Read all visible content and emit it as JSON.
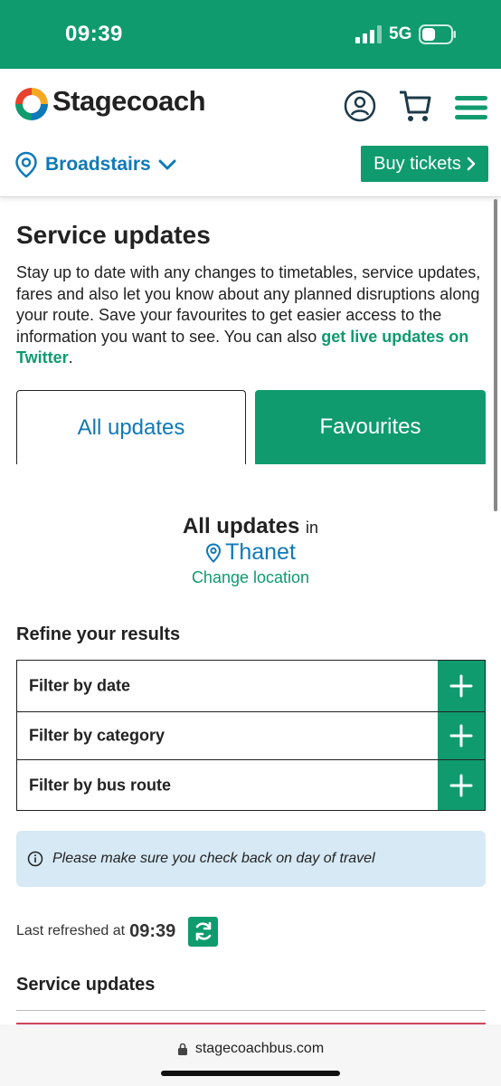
{
  "status": {
    "time": "09:39",
    "network": "5G"
  },
  "header": {
    "brand": "Stagecoach",
    "location": "Broadstairs",
    "buy_label": "Buy tickets"
  },
  "main": {
    "title": "Service updates",
    "intro": "Stay up to date with any changes to timetables, service updates, fares and also let you know about any planned disruptions along your route. Save your favourites to get easier access to the information you want to see. You can also ",
    "intro_link": "get live updates on Twitter",
    "intro_end": ".",
    "tabs": {
      "all": "All updates",
      "favourites": "Favourites"
    },
    "all_updates_heading": "All updates",
    "in_word": "in",
    "place": "Thanet",
    "change_location": "Change location",
    "refine": "Refine your results",
    "filters": [
      "Filter by date",
      "Filter by category",
      "Filter by bus route"
    ],
    "notice": "Please make sure you check back on day of travel",
    "last_refreshed_label": "Last refreshed at",
    "last_refreshed_time": "09:39",
    "section_title": "Service updates"
  },
  "browser": {
    "url": "stagecoachbus.com"
  },
  "colors": {
    "brand_green": "#0f9b6e",
    "link_blue": "#0f79b8",
    "notice_bg": "#d6e9f5"
  },
  "icons": [
    "signal-icon",
    "battery-icon",
    "logo-icon",
    "account-icon",
    "cart-icon",
    "menu-icon",
    "location-pin-icon",
    "chevron-down-icon",
    "chevron-right-icon",
    "plus-icon",
    "info-icon",
    "refresh-icon",
    "lock-icon"
  ]
}
